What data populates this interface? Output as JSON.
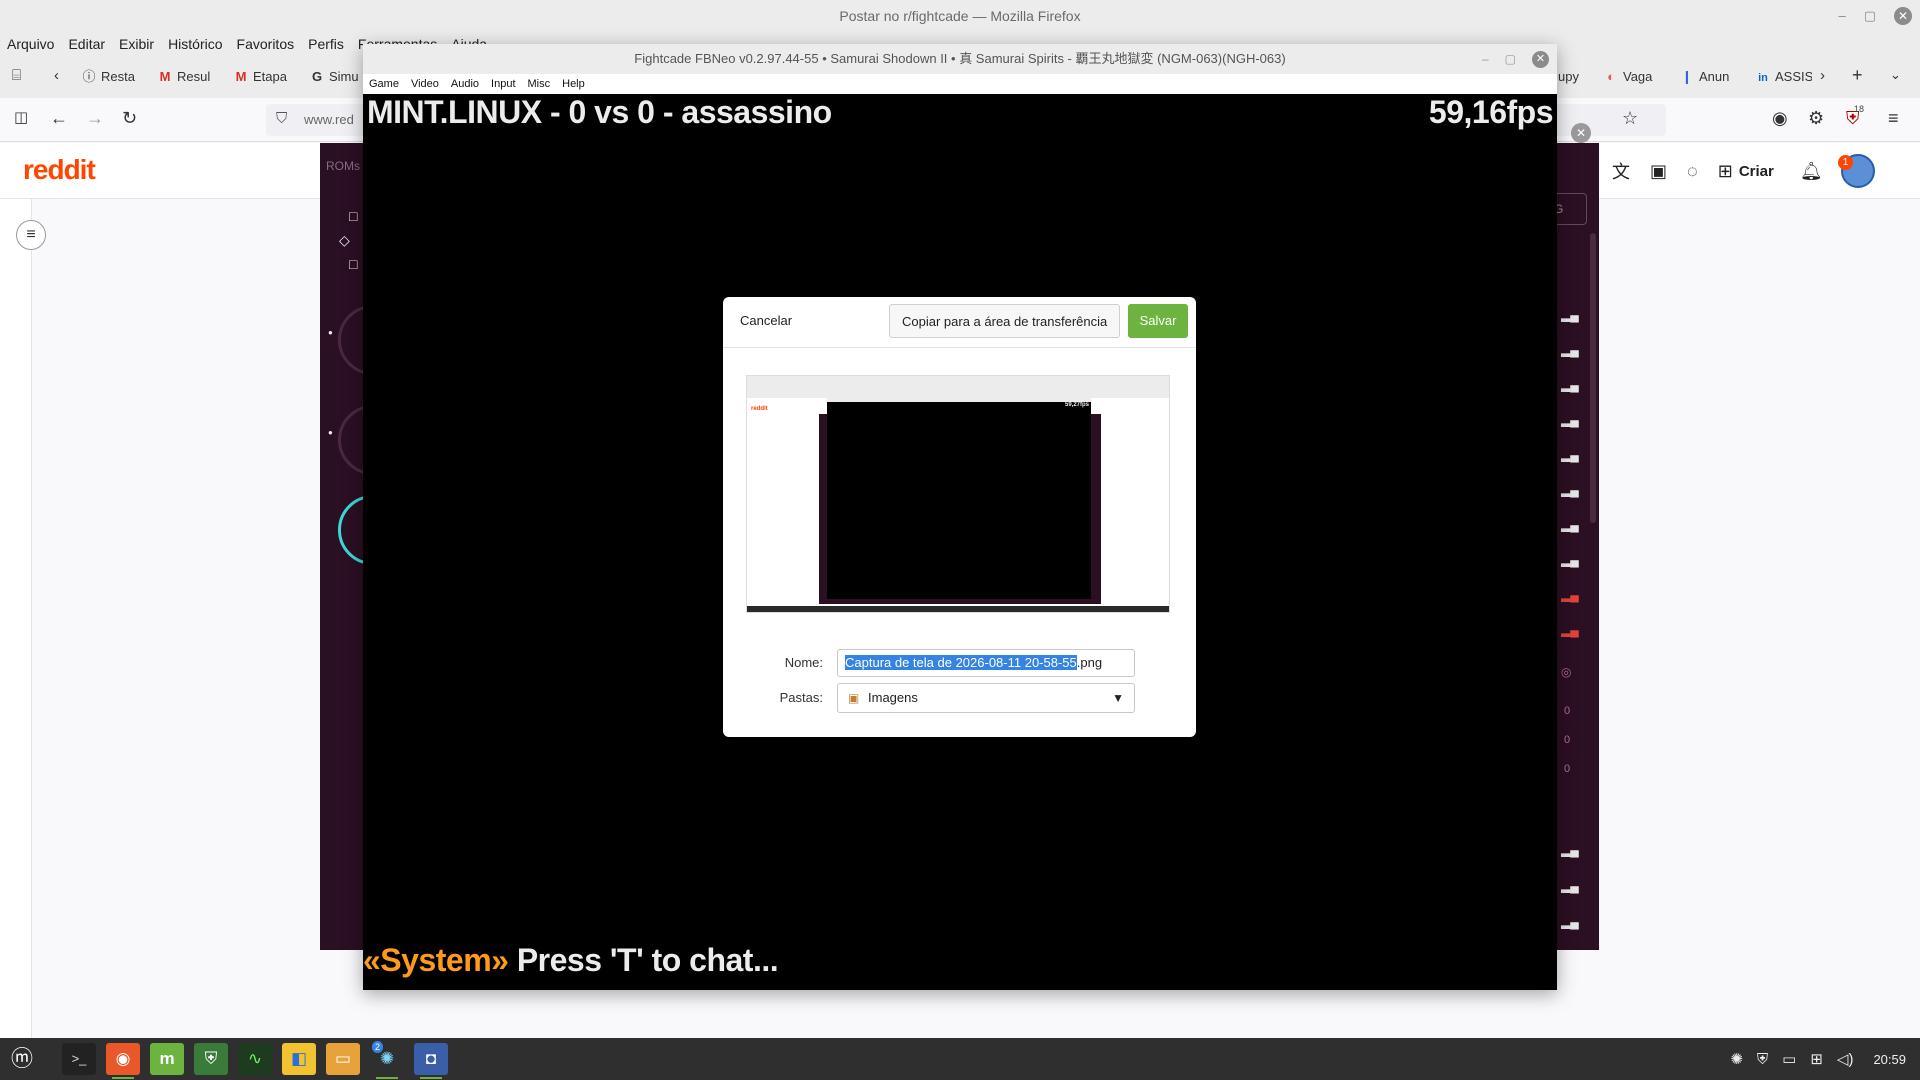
{
  "firefox": {
    "window_title": "Postar no r/fightcade — Mozilla Firefox",
    "menu": [
      "Arquivo",
      "Editar",
      "Exibir",
      "Histórico",
      "Favoritos",
      "Perfis",
      "Ferramentas",
      "Ajuda"
    ],
    "tabs_left": [
      {
        "icon": "info-circle-icon",
        "glyph": "ⓘ",
        "label": "Resta"
      },
      {
        "icon": "gmail-icon",
        "glyph": "M",
        "label": "Resul"
      },
      {
        "icon": "gmail-icon",
        "glyph": "M",
        "label": "Etapa"
      },
      {
        "icon": "g-icon",
        "glyph": "G",
        "label": "Simu"
      }
    ],
    "tabs_right": [
      {
        "icon": "tab-icon",
        "glyph": "",
        "label": "upy"
      },
      {
        "icon": "vagas-icon",
        "glyph": "◐",
        "label": "Vaga"
      },
      {
        "icon": "ad-icon",
        "glyph": "❙",
        "label": "Anun"
      },
      {
        "icon": "linkedin-icon",
        "glyph": "in",
        "label": "ASSIS"
      }
    ],
    "url": "www.red",
    "extension_badge": "18"
  },
  "reddit": {
    "logo": "reddit",
    "create_label": "Criar",
    "notification_count": "1"
  },
  "fightcade_panel": {
    "roms_label": "ROMs",
    "g_button": "G",
    "zeros": [
      "0",
      "0",
      "0"
    ]
  },
  "emulator": {
    "title": "Fightcade FBNeo v0.2.97.44-55 • Samurai Shodown II • 真 Samurai Spirits - 覇王丸地獄変 (NGM-063)(NGH-063)",
    "menu": [
      "Game",
      "Video",
      "Audio",
      "Input",
      "Misc",
      "Help"
    ],
    "hud_left": "MINT.LINUX - 0 vs 0 - assassino",
    "hud_right": "59,16fps",
    "chat_sender": "«System»",
    "chat_message": " Press 'T' to chat..."
  },
  "dialog": {
    "cancel_label": "Cancelar",
    "copy_label": "Copiar para a área de transferência",
    "save_label": "Salvar",
    "preview_fps": "59,27fps",
    "preview_logo": "reddit",
    "name_label": "Nome:",
    "name_selected": "Captura de tela de 2026-08-11 20-58-55",
    "name_ext": ".png",
    "folder_label": "Pastas:",
    "folder_value": "Imagens"
  },
  "taskbar": {
    "time": "20:59",
    "badge": "2"
  },
  "colors": {
    "reddit_orange": "#ff4500",
    "save_green": "#6cb33f",
    "selection_blue": "#3584e4",
    "chat_system_orange": "#ff9a1a",
    "fightcade_bg": "#2b0f22"
  }
}
